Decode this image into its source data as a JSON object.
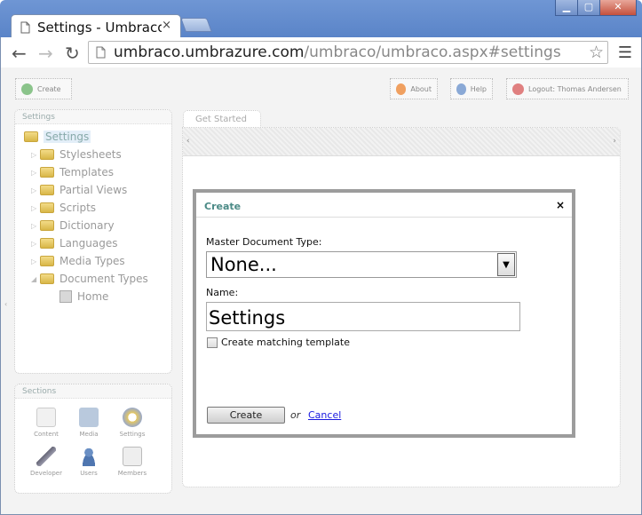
{
  "browser": {
    "tab_title": "Settings - Umbraco C",
    "tab_close": "×",
    "url_host": "umbraco.umbrazure.com",
    "url_path": "/umbraco/umbraco.aspx#settings",
    "window_controls": [
      "▁",
      "▢",
      "✕"
    ]
  },
  "topbar": {
    "create_label": "Create",
    "about_label": "About",
    "help_label": "Help",
    "logout_label": "Logout: Thomas Andersen"
  },
  "tree": {
    "header": "Settings",
    "root": "Settings",
    "items": [
      "Stylesheets",
      "Templates",
      "Partial Views",
      "Scripts",
      "Dictionary",
      "Languages",
      "Media Types",
      "Document Types"
    ],
    "child": "Home"
  },
  "sections": {
    "header": "Sections",
    "items": [
      "Content",
      "Media",
      "Settings",
      "Developer",
      "Users",
      "Members"
    ]
  },
  "main": {
    "tab_label": "Get Started",
    "scroll_left": "‹",
    "scroll_right": "›"
  },
  "dialog": {
    "title": "Create",
    "close": "×",
    "master_label": "Master Document Type:",
    "master_value": "None...",
    "name_label": "Name:",
    "name_value": "Settings",
    "checkbox_label": "Create matching template",
    "create_button": "Create",
    "or_text": "or",
    "cancel_link": "Cancel"
  }
}
